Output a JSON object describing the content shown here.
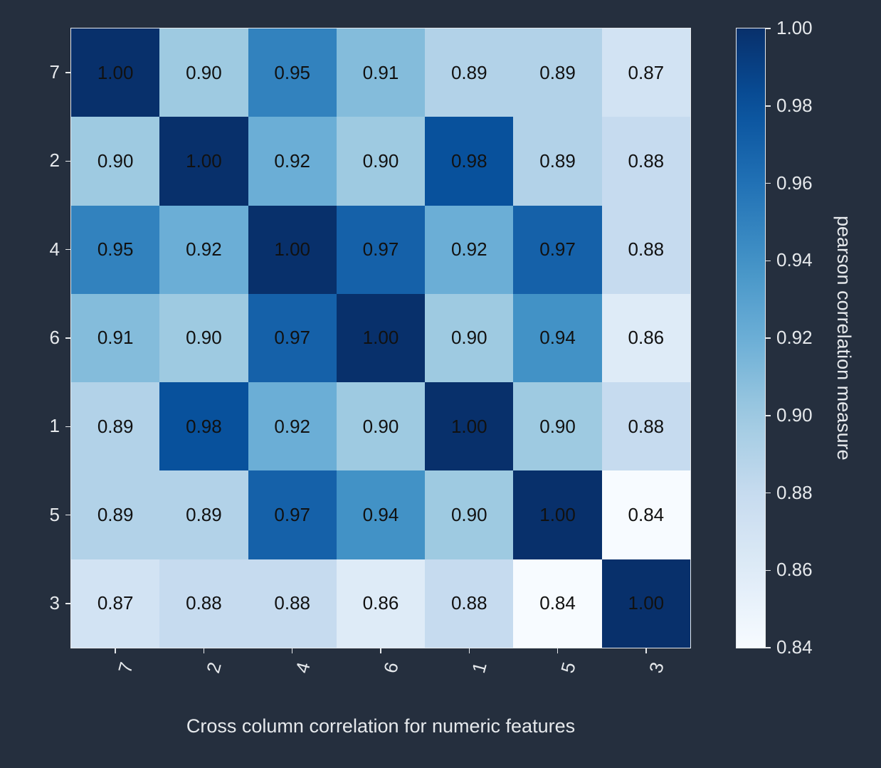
{
  "chart_data": {
    "type": "heatmap",
    "title": "",
    "xlabel": "Cross column correlation for numeric features",
    "ylabel": "",
    "cbar_label": "pearson correlation measure",
    "x_categories": [
      "7",
      "2",
      "4",
      "6",
      "1",
      "5",
      "3"
    ],
    "y_categories": [
      "7",
      "2",
      "4",
      "6",
      "1",
      "5",
      "3"
    ],
    "matrix": [
      [
        1.0,
        0.9,
        0.95,
        0.91,
        0.89,
        0.89,
        0.87
      ],
      [
        0.9,
        1.0,
        0.92,
        0.9,
        0.98,
        0.89,
        0.88
      ],
      [
        0.95,
        0.92,
        1.0,
        0.97,
        0.92,
        0.97,
        0.88
      ],
      [
        0.91,
        0.9,
        0.97,
        1.0,
        0.9,
        0.94,
        0.86
      ],
      [
        0.89,
        0.98,
        0.92,
        0.9,
        1.0,
        0.9,
        0.88
      ],
      [
        0.89,
        0.89,
        0.97,
        0.94,
        0.9,
        1.0,
        0.84
      ],
      [
        0.87,
        0.88,
        0.88,
        0.86,
        0.88,
        0.84,
        1.0
      ]
    ],
    "vmin": 0.84,
    "vmax": 1.0,
    "cbar_ticks": [
      1.0,
      0.98,
      0.96,
      0.94,
      0.92,
      0.9,
      0.88,
      0.86,
      0.84
    ],
    "colormap": "Blues"
  }
}
